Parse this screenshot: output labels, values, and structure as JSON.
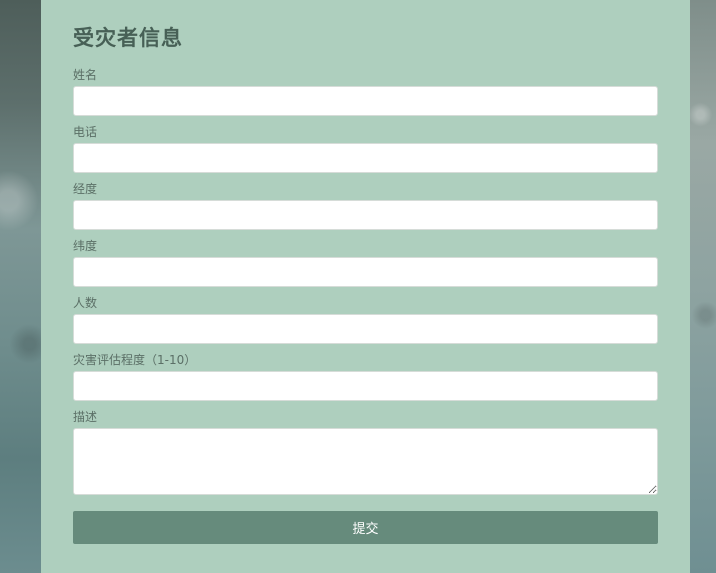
{
  "form": {
    "title": "受灾者信息",
    "fields": [
      {
        "label": "姓名",
        "value": ""
      },
      {
        "label": "电话",
        "value": ""
      },
      {
        "label": "经度",
        "value": ""
      },
      {
        "label": "纬度",
        "value": ""
      },
      {
        "label": "人数",
        "value": ""
      },
      {
        "label": "灾害评估程度（1-10）",
        "value": ""
      }
    ],
    "description": {
      "label": "描述",
      "value": ""
    },
    "submit_label": "提交"
  },
  "colors": {
    "panel_bg": "#aecfbe",
    "title": "#476056",
    "label": "#5b6f66",
    "button_bg": "#668b7c",
    "button_text": "#ffffff"
  }
}
